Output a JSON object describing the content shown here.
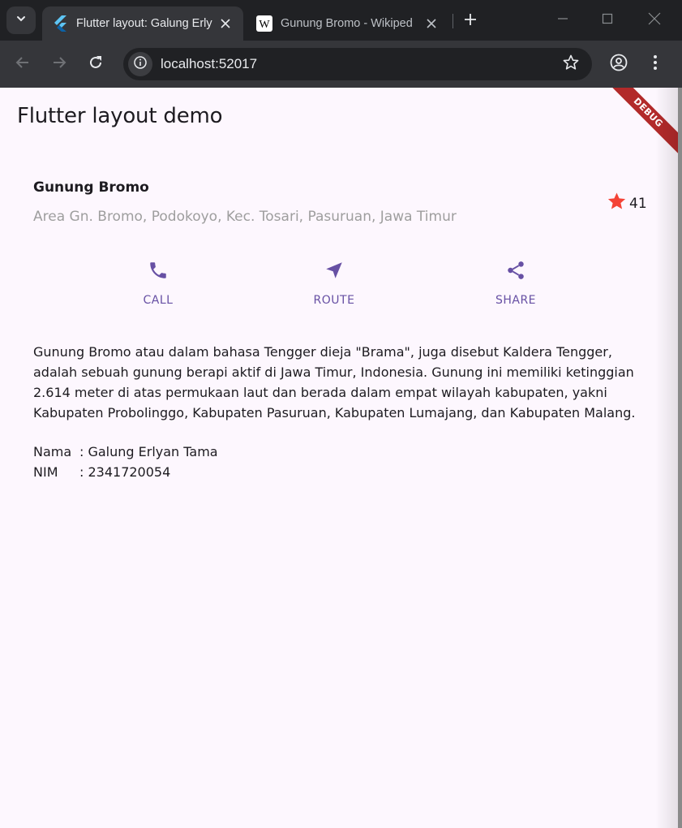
{
  "browser": {
    "tabs": [
      {
        "title": "Flutter layout: Galung Erly",
        "active": true,
        "icon": "flutter-icon"
      },
      {
        "title": "Gunung Bromo - Wikiped",
        "active": false,
        "icon": "wikipedia-icon"
      }
    ],
    "address": "localhost:52017"
  },
  "app": {
    "title": "Flutter layout demo",
    "debug_banner": "DEBUG"
  },
  "place": {
    "name": "Gunung Bromo",
    "address": "Area Gn. Bromo, Podokoyo, Kec. Tosari, Pasuruan, Jawa Timur",
    "rating_count": "41",
    "rating_color": "#f44336"
  },
  "actions": [
    {
      "label": "CALL",
      "icon": "phone-icon"
    },
    {
      "label": "ROUTE",
      "icon": "navigation-icon"
    },
    {
      "label": "SHARE",
      "icon": "share-icon"
    }
  ],
  "accent_color": "#6750a4",
  "description": "Gunung Bromo atau dalam bahasa Tengger dieja \"Brama\", juga disebut Kaldera Tengger, adalah sebuah gunung berapi aktif di Jawa Timur, Indonesia. Gunung ini memiliki ketinggian 2.614 meter di atas permukaan laut dan berada dalam empat wilayah kabupaten, yakni Kabupaten Probolinggo, Kabupaten Pasuruan, Kabupaten Lumajang, dan Kabupaten Malang.",
  "identity": {
    "nama_label": "Nama",
    "nama_value": ": Galung Erlyan Tama",
    "nim_label": "NIM",
    "nim_value": ": 2341720054"
  }
}
